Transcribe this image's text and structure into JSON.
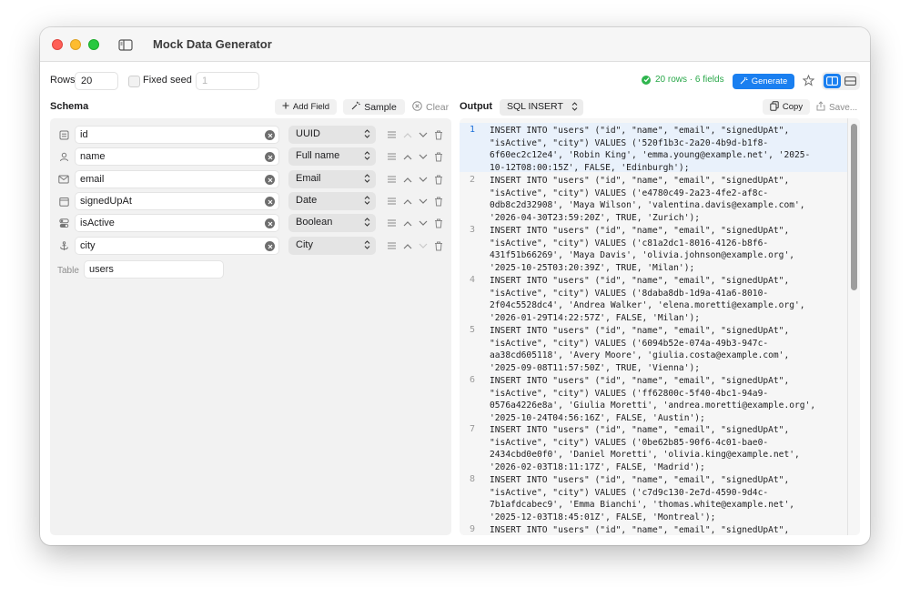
{
  "app": {
    "title": "Mock Data Generator"
  },
  "toolbar": {
    "rows_label": "Rows",
    "rows_value": "20",
    "fixed_seed_label": "Fixed seed",
    "seed_placeholder": "1",
    "status_text": "20 rows · 6 fields",
    "generate_label": "Generate"
  },
  "schema": {
    "title": "Schema",
    "add_field_label": "Add Field",
    "sample_label": "Sample",
    "clear_label": "Clear",
    "fields": [
      {
        "name": "id",
        "type": "UUID",
        "icon": "id-card-icon"
      },
      {
        "name": "name",
        "type": "Full name",
        "icon": "person-icon"
      },
      {
        "name": "email",
        "type": "Email",
        "icon": "envelope-icon"
      },
      {
        "name": "signedUpAt",
        "type": "Date",
        "icon": "calendar-icon"
      },
      {
        "name": "isActive",
        "type": "Boolean",
        "icon": "toggle-icon"
      },
      {
        "name": "city",
        "type": "City",
        "icon": "anchor-icon"
      }
    ],
    "table_label": "Table",
    "table_value": "users"
  },
  "output": {
    "title": "Output",
    "format": "SQL INSERT",
    "copy_label": "Copy",
    "save_label": "Save...",
    "lines": [
      {
        "n": "1",
        "text": "INSERT INTO \"users\" (\"id\", \"name\", \"email\", \"signedUpAt\",\n\"isActive\", \"city\") VALUES ('520f1b3c-2a20-4b9d-b1f8-\n6f60ec2c12e4', 'Robin King', 'emma.young@example.net', '2025-\n10-12T08:00:15Z', FALSE, 'Edinburgh');"
      },
      {
        "n": "2",
        "text": "INSERT INTO \"users\" (\"id\", \"name\", \"email\", \"signedUpAt\",\n\"isActive\", \"city\") VALUES ('e4780c49-2a23-4fe2-af8c-\n0db8c2d32908', 'Maya Wilson', 'valentina.davis@example.com',\n'2026-04-30T23:59:20Z', TRUE, 'Zurich');"
      },
      {
        "n": "3",
        "text": "INSERT INTO \"users\" (\"id\", \"name\", \"email\", \"signedUpAt\",\n\"isActive\", \"city\") VALUES ('c81a2dc1-8016-4126-b8f6-\n431f51b66269', 'Maya Davis', 'olivia.johnson@example.org',\n'2025-10-25T03:20:39Z', TRUE, 'Milan');"
      },
      {
        "n": "4",
        "text": "INSERT INTO \"users\" (\"id\", \"name\", \"email\", \"signedUpAt\",\n\"isActive\", \"city\") VALUES ('8daba8db-1d9a-41a6-8010-\n2f04c5528dc4', 'Andrea Walker', 'elena.moretti@example.org',\n'2026-01-29T14:22:57Z', FALSE, 'Milan');"
      },
      {
        "n": "5",
        "text": "INSERT INTO \"users\" (\"id\", \"name\", \"email\", \"signedUpAt\",\n\"isActive\", \"city\") VALUES ('6094b52e-074a-49b3-947c-\naa38cd605118', 'Avery Moore', 'giulia.costa@example.com',\n'2025-09-08T11:57:50Z', TRUE, 'Vienna');"
      },
      {
        "n": "6",
        "text": "INSERT INTO \"users\" (\"id\", \"name\", \"email\", \"signedUpAt\",\n\"isActive\", \"city\") VALUES ('ff62800c-5f40-4bc1-94a9-\n0576a4226e8a', 'Giulia Moretti', 'andrea.moretti@example.org',\n'2025-10-24T04:56:16Z', FALSE, 'Austin');"
      },
      {
        "n": "7",
        "text": "INSERT INTO \"users\" (\"id\", \"name\", \"email\", \"signedUpAt\",\n\"isActive\", \"city\") VALUES ('0be62b85-90f6-4c01-bae0-\n2434cbd0e0f0', 'Daniel Moretti', 'olivia.king@example.net',\n'2026-02-03T18:11:17Z', FALSE, 'Madrid');"
      },
      {
        "n": "8",
        "text": "INSERT INTO \"users\" (\"id\", \"name\", \"email\", \"signedUpAt\",\n\"isActive\", \"city\") VALUES ('c7d9c130-2e7d-4590-9d4c-\n7b1afdcabec9', 'Emma Bianchi', 'thomas.white@example.net',\n'2025-12-03T18:45:01Z', FALSE, 'Montreal');"
      },
      {
        "n": "9",
        "text": "INSERT INTO \"users\" (\"id\", \"name\", \"email\", \"signedUpAt\","
      }
    ]
  },
  "colors": {
    "accent": "#1a7ff0",
    "success": "#2fb54e"
  }
}
